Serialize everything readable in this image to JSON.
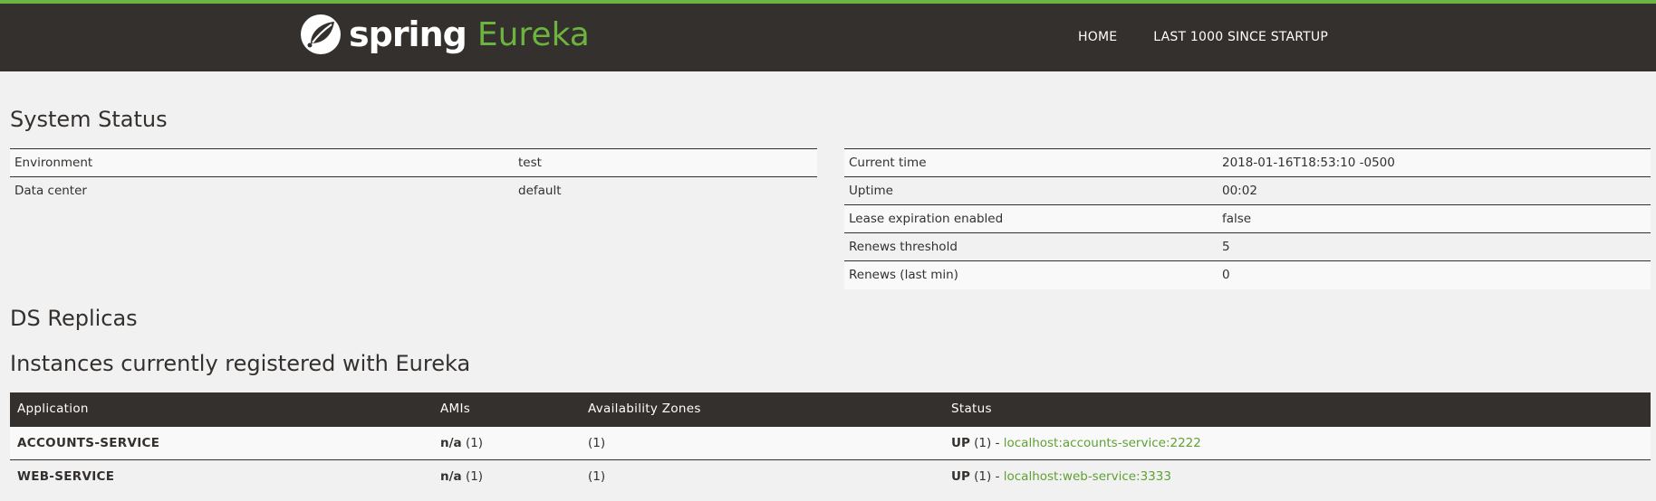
{
  "header": {
    "brand_spring": "spring",
    "brand_eureka": "Eureka",
    "nav": {
      "home": "HOME",
      "last1000": "LAST 1000 SINCE STARTUP"
    }
  },
  "colors": {
    "accent": "#6db33f",
    "dark": "#34302d",
    "link": "#5fa134"
  },
  "system_status": {
    "title": "System Status",
    "left": [
      {
        "key": "Environment",
        "value": "test"
      },
      {
        "key": "Data center",
        "value": "default"
      }
    ],
    "right": [
      {
        "key": "Current time",
        "value": "2018-01-16T18:53:10 -0500"
      },
      {
        "key": "Uptime",
        "value": "00:02"
      },
      {
        "key": "Lease expiration enabled",
        "value": "false"
      },
      {
        "key": "Renews threshold",
        "value": "5"
      },
      {
        "key": "Renews (last min)",
        "value": "0"
      }
    ]
  },
  "ds_replicas": {
    "title": "DS Replicas"
  },
  "instances": {
    "title": "Instances currently registered with Eureka",
    "columns": [
      "Application",
      "AMIs",
      "Availability Zones",
      "Status"
    ],
    "rows": [
      {
        "application": "ACCOUNTS-SERVICE",
        "amis_bold": "n/a",
        "amis_count": "(1)",
        "zones": "(1)",
        "status_bold": "UP",
        "status_count": "(1) -",
        "status_link": "localhost:accounts-service:2222"
      },
      {
        "application": "WEB-SERVICE",
        "amis_bold": "n/a",
        "amis_count": "(1)",
        "zones": "(1)",
        "status_bold": "UP",
        "status_count": "(1) -",
        "status_link": "localhost:web-service:3333"
      }
    ]
  }
}
